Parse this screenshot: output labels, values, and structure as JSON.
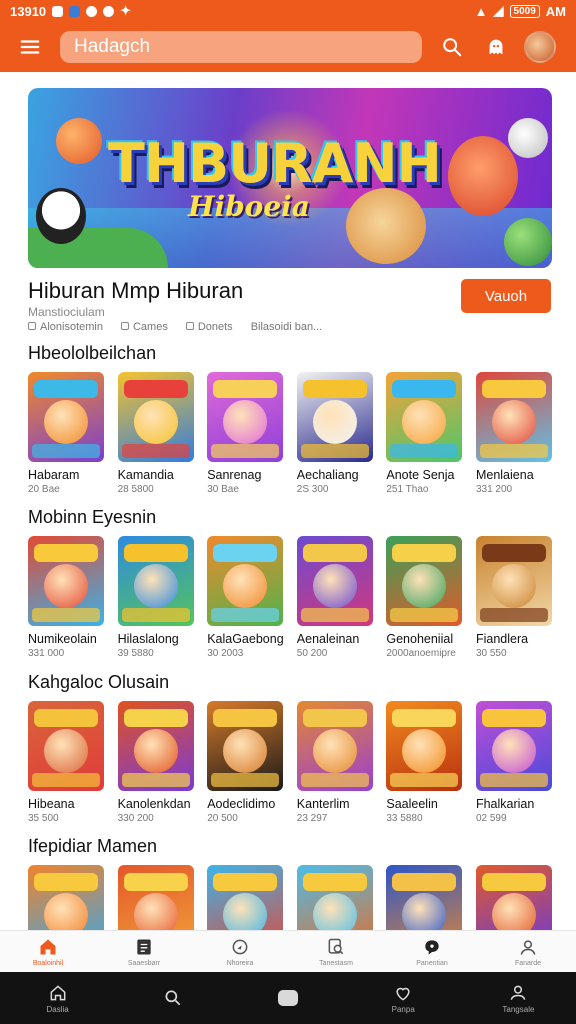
{
  "status_bar": {
    "time": "13910",
    "battery": "5009",
    "ampm": "AM"
  },
  "header": {
    "search_value": "Hadagch",
    "icons": [
      "menu-icon",
      "search-icon",
      "notification-icon",
      "avatar"
    ]
  },
  "banner": {
    "title": "THBURANH",
    "subtitle": "Hiboeia"
  },
  "app": {
    "title": "Hiburan Mmp Hiburan",
    "subtitle": "Manstiociulam",
    "meta": [
      "Alonisotemin",
      "Cames",
      "Donets",
      "Bilasoidi ban..."
    ],
    "install_label": "Vauoh"
  },
  "sections": [
    {
      "title": "Hbeololbeilchan",
      "items": [
        {
          "name": "Habaram",
          "stat": "20 Bae",
          "c1": "#f08a2a",
          "c2": "#3cb9e6",
          "c3": "#7a3fd1"
        },
        {
          "name": "Kamandia",
          "stat": "28 5800",
          "c1": "#f5c22e",
          "c2": "#e8403a",
          "c3": "#2f7de0"
        },
        {
          "name": "Sanrenag",
          "stat": "30 Bae",
          "c1": "#e06bd8",
          "c2": "#f7d05a",
          "c3": "#8e3fd9"
        },
        {
          "name": "Aechaliang",
          "stat": "2S 300",
          "c1": "#f2f2f2",
          "c2": "#f5c22e",
          "c3": "#2a2a8f"
        },
        {
          "name": "Anote Senja",
          "stat": "251 Thao",
          "c1": "#f5a23a",
          "c2": "#3bb7f0",
          "c3": "#4cc76a"
        },
        {
          "name": "Menlaiena",
          "stat": "331 200",
          "c1": "#e0473a",
          "c2": "#f8c93e",
          "c3": "#5fc2e8"
        }
      ]
    },
    {
      "title": "Mobinn Eyesnin",
      "items": [
        {
          "name": "Numikeolain",
          "stat": "331 000",
          "c1": "#e24a35",
          "c2": "#f7c93b",
          "c3": "#38b3ea"
        },
        {
          "name": "Hilaslalong",
          "stat": "39 5880",
          "c1": "#2e8ae0",
          "c2": "#f5c22e",
          "c3": "#55c45c"
        },
        {
          "name": "KalaGaebong",
          "stat": "30 2003",
          "c1": "#f0892c",
          "c2": "#6bd2f0",
          "c3": "#4fb34c"
        },
        {
          "name": "Aenaleinan",
          "stat": "50 200",
          "c1": "#6d4bd0",
          "c2": "#f3c84a",
          "c3": "#d1387e"
        },
        {
          "name": "Genoheniial",
          "stat": "2000anoemipre",
          "c1": "#3aa05a",
          "c2": "#f7d04a",
          "c3": "#e05a2a"
        },
        {
          "name": "Fiandlera",
          "stat": "30 550",
          "c1": "#c8822e",
          "c2": "#7a3a1a",
          "c3": "#f2d8a8"
        }
      ]
    },
    {
      "title": "Kahgaloc Olusain",
      "items": [
        {
          "name": "Hibeana",
          "stat": "35 500",
          "c1": "#d9663a",
          "c2": "#f4c23b",
          "c3": "#e03b3b"
        },
        {
          "name": "Kanolenkdan",
          "stat": "330 200",
          "c1": "#e0531f",
          "c2": "#f6d24a",
          "c3": "#7b3ad6"
        },
        {
          "name": "Aodeclidimo",
          "stat": "20 500",
          "c1": "#d67a2a",
          "c2": "#f5c542",
          "c3": "#1a1a1a"
        },
        {
          "name": "Kanterlim",
          "stat": "23 297",
          "c1": "#e4892f",
          "c2": "#f2c64b",
          "c3": "#9a3fd0"
        },
        {
          "name": "Saaleelin",
          "stat": "33 5880",
          "c1": "#f28b1f",
          "c2": "#f9d65a",
          "c3": "#b8300f"
        },
        {
          "name": "Fhalkarian",
          "stat": "02 599",
          "c1": "#c24fd6",
          "c2": "#f7c43c",
          "c3": "#4a4ad9"
        }
      ]
    },
    {
      "title": "Ifepidiar Mamen",
      "items": [
        {
          "name": "",
          "stat": "",
          "c1": "#f0822c",
          "c2": "#f6c93e",
          "c3": "#3aa7e6"
        },
        {
          "name": "",
          "stat": "",
          "c1": "#e4572a",
          "c2": "#f8d24a",
          "c3": "#f1a23a"
        },
        {
          "name": "",
          "stat": "",
          "c1": "#3db4e8",
          "c2": "#f6c93e",
          "c3": "#e0493a"
        },
        {
          "name": "",
          "stat": "",
          "c1": "#4cbde9",
          "c2": "#f6c93e",
          "c3": "#e36d2c"
        },
        {
          "name": "",
          "stat": "",
          "c1": "#2d56c9",
          "c2": "#f3c048",
          "c3": "#d9863a"
        },
        {
          "name": "",
          "stat": "",
          "c1": "#e05a2c",
          "c2": "#f7c93e",
          "c3": "#6a3ad6"
        }
      ]
    }
  ],
  "bottom_tabs": [
    {
      "label": "Boaloinhil",
      "icon": "home-icon",
      "active": true
    },
    {
      "label": "Saaesbarr",
      "icon": "list-icon",
      "active": false
    },
    {
      "label": "Nhoreira",
      "icon": "compass-icon",
      "active": false
    },
    {
      "label": "Tanestasm",
      "icon": "search-doc-icon",
      "active": false
    },
    {
      "label": "Panentian",
      "icon": "chat-icon",
      "active": false
    },
    {
      "label": "Fanarde",
      "icon": "user-icon",
      "active": false
    }
  ],
  "system_nav": [
    {
      "label": "Daslia",
      "icon": "home-outline-icon"
    },
    {
      "label": "",
      "icon": "search-icon"
    },
    {
      "label": "",
      "icon": "home-pill"
    },
    {
      "label": "Panpa",
      "icon": "heart-icon"
    },
    {
      "label": "Tangsale",
      "icon": "profile-icon"
    }
  ],
  "colors": {
    "accent": "#ee5a1c"
  }
}
